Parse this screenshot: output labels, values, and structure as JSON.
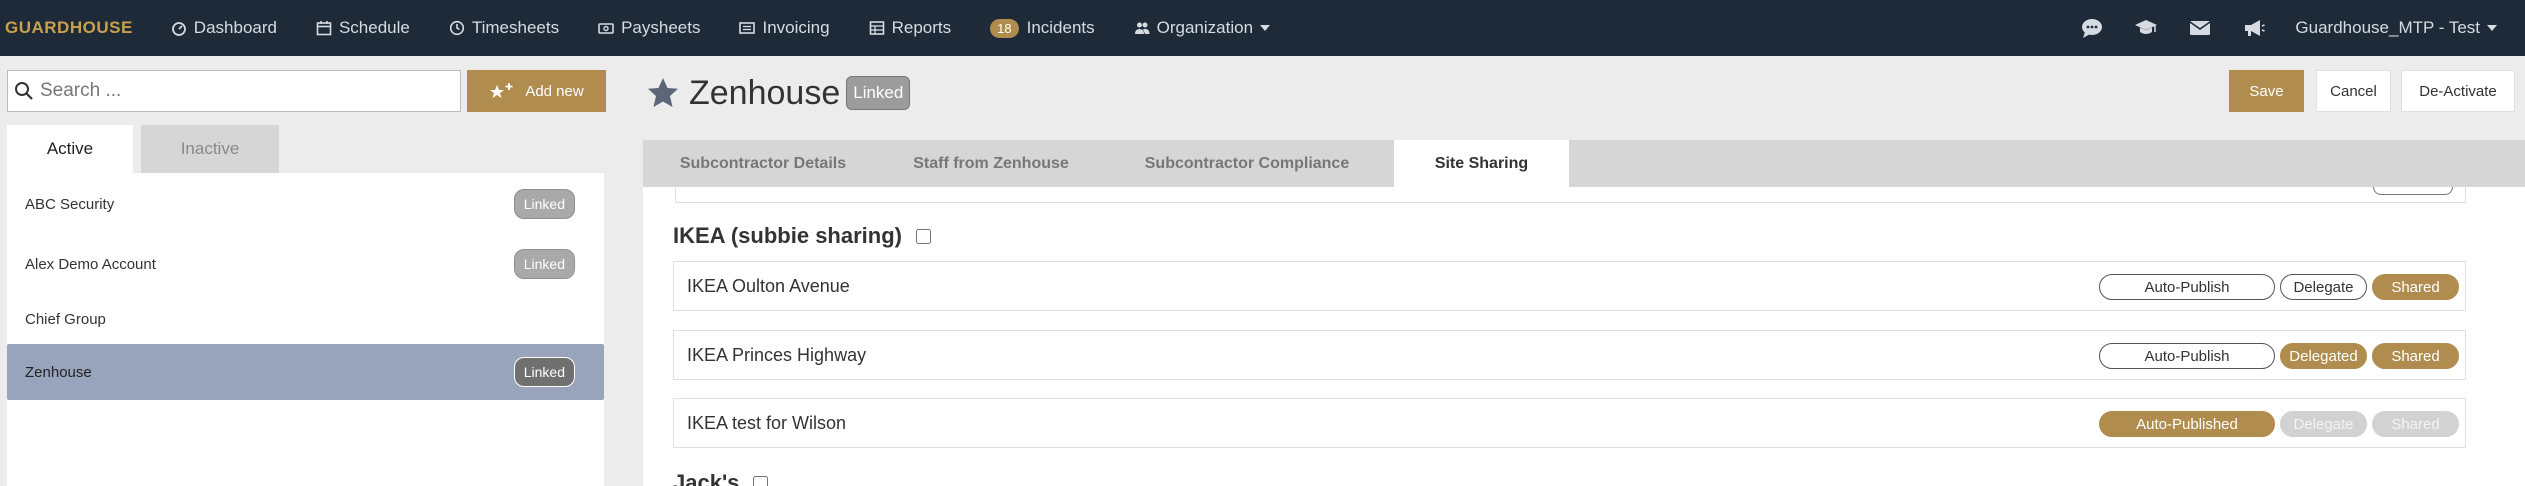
{
  "nav": {
    "logo": "GUARDHOUSE",
    "items": [
      {
        "label": "Dashboard",
        "icon": "dashboard-icon"
      },
      {
        "label": "Schedule",
        "icon": "calendar-icon"
      },
      {
        "label": "Timesheets",
        "icon": "clock-icon"
      },
      {
        "label": "Paysheets",
        "icon": "money-icon"
      },
      {
        "label": "Invoicing",
        "icon": "invoice-icon"
      },
      {
        "label": "Reports",
        "icon": "table-icon"
      },
      {
        "label": "Incidents",
        "count": "18"
      },
      {
        "label": "Organization",
        "icon": "users-icon"
      }
    ],
    "right_icons": [
      "chat-icon",
      "graduation-cap-icon",
      "envelope-icon",
      "megaphone-icon"
    ],
    "user": "Guardhouse_MTP - Test"
  },
  "left": {
    "search_placeholder": "Search ...",
    "add_new": "Add new",
    "tabs": {
      "active": "Active",
      "inactive": "Inactive"
    },
    "items": [
      {
        "name": "ABC Security",
        "badge": "Linked"
      },
      {
        "name": "Alex Demo Account",
        "badge": "Linked"
      },
      {
        "name": "Chief Group",
        "badge": ""
      },
      {
        "name": "Zenhouse",
        "badge": "Linked",
        "selected": true
      }
    ]
  },
  "header": {
    "title": "Zenhouse",
    "badge": "Linked",
    "save": "Save",
    "cancel": "Cancel",
    "deactivate": "De-Activate"
  },
  "tabs": [
    {
      "label": "Subcontractor Details"
    },
    {
      "label": "Staff from Zenhouse"
    },
    {
      "label": "Subcontractor Compliance"
    },
    {
      "label": "Site Sharing",
      "active": true
    }
  ],
  "site_sharing": {
    "groups": [
      {
        "name": "IKEA (subbie sharing)",
        "sites": [
          {
            "name": "IKEA Oulton Avenue",
            "pills": [
              {
                "label": "Auto-Publish",
                "state": "off"
              },
              {
                "label": "Delegate",
                "state": "off"
              },
              {
                "label": "Shared",
                "state": "on"
              }
            ]
          },
          {
            "name": "IKEA Princes Highway",
            "pills": [
              {
                "label": "Auto-Publish",
                "state": "off"
              },
              {
                "label": "Delegated",
                "state": "on"
              },
              {
                "label": "Shared",
                "state": "on"
              }
            ]
          },
          {
            "name": "IKEA test for Wilson",
            "pills": [
              {
                "label": "Auto-Published",
                "state": "on"
              },
              {
                "label": "Delegate",
                "state": "disabled"
              },
              {
                "label": "Shared",
                "state": "disabled"
              }
            ]
          }
        ]
      },
      {
        "name": "Jack's",
        "sites": []
      }
    ]
  },
  "colors": {
    "nav_bg": "#1e2a38",
    "accent": "#b08d4e",
    "selected_row": "#98a4bb"
  }
}
